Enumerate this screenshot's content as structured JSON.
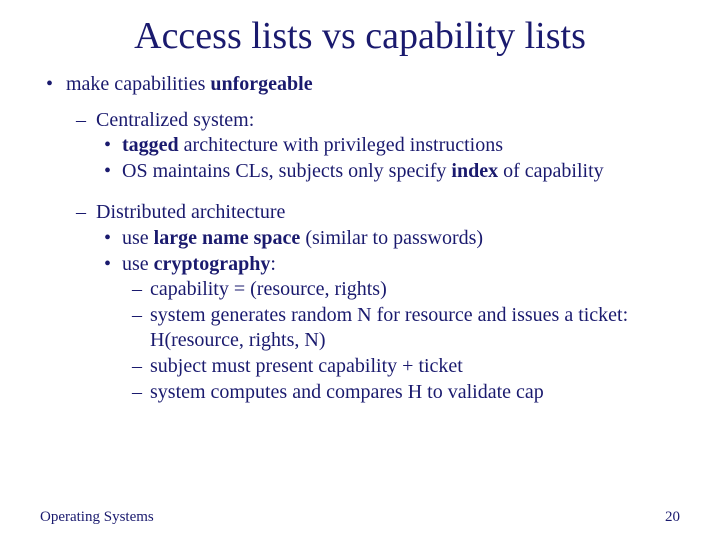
{
  "title": "Access lists vs capability lists",
  "b1": {
    "p1": "make capabilities ",
    "p2": "unforgeable"
  },
  "c1": {
    "head": "Centralized system:",
    "i1": {
      "p1": "tagged",
      "p2": " architecture with privileged instructions"
    },
    "i2": {
      "p1": "OS maintains CLs, subjects only specify ",
      "p2": "index",
      "p3": " of capability"
    }
  },
  "c2": {
    "head": "Distributed architecture",
    "i1": {
      "p1": "use ",
      "p2": "large name space",
      "p3": " (similar to passwords)"
    },
    "i2": {
      "p1": "use ",
      "p2": "cryptography",
      "p3": ":"
    },
    "s1": "capability = (resource, rights)",
    "s2": "system generates random N for resource and issues a ticket: H(resource, rights, N)",
    "s3": "subject must present capability + ticket",
    "s4": "system computes and compares H to validate cap"
  },
  "footer": {
    "left": "Operating Systems",
    "right": "20"
  }
}
